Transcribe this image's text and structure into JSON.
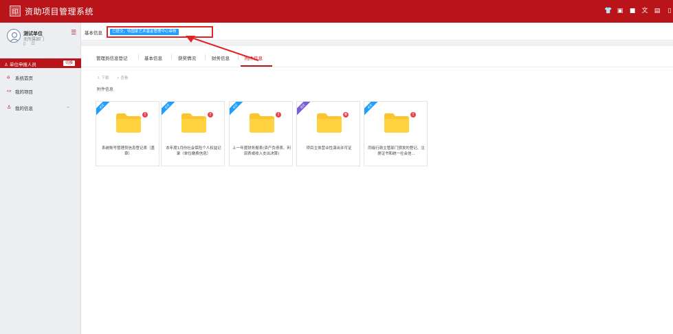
{
  "app": {
    "title": "资助项目管理系统",
    "logo_icon": "seal-logo-icon",
    "brand_color": "#b8141a"
  },
  "topbar": {
    "icons": [
      {
        "name": "shirt-icon",
        "glyph": "👕"
      },
      {
        "name": "archive-icon",
        "glyph": "▣"
      },
      {
        "name": "message-icon",
        "glyph": "■"
      },
      {
        "name": "font-icon",
        "glyph": "文"
      },
      {
        "name": "translate-icon",
        "glyph": "▤"
      },
      {
        "name": "more-icon",
        "glyph": "▯"
      }
    ]
  },
  "sidebar": {
    "unit_name": "测试单位",
    "unit_dept": "无所属部门",
    "mini_icons": [
      "▯",
      "☷"
    ],
    "role": "单位申报人员",
    "switch_label": "切换",
    "items": [
      {
        "label": "系统首页",
        "icon": "⌂",
        "icon_name": "home-icon"
      },
      {
        "label": "我的项目",
        "icon": "▭",
        "icon_name": "folder-icon"
      },
      {
        "label": "我的信息",
        "icon": "♙",
        "icon_name": "user-icon",
        "arrow": "⌄"
      }
    ]
  },
  "header": {
    "breadcrumb": "基本信息",
    "status": "已提交，待国家艺术基金管理中心审核"
  },
  "tabs": [
    {
      "label": "管理员信息登记",
      "active": false
    },
    {
      "label": "基本信息",
      "active": false
    },
    {
      "label": "获奖情况",
      "active": false
    },
    {
      "label": "财务信息",
      "active": false
    },
    {
      "label": "附件信息",
      "active": true
    }
  ],
  "toolbar": {
    "download": "下载",
    "view": "查看"
  },
  "section_label": "附件信息",
  "attachments": [
    {
      "name": "系统账号管理员信息登记表（盖章）",
      "badge": "!",
      "ribbon": "必交",
      "ribbon_color": "#1e9fff"
    },
    {
      "name": "本年度1月份社会保险个人权益记录（单位缴费信息）",
      "badge": "!",
      "ribbon": "必交",
      "ribbon_color": "#1e9fff"
    },
    {
      "name": "上一年度财务报表(资产负债表、利润表或收入支出决算)",
      "badge": "!",
      "ribbon": "必交",
      "ribbon_color": "#1e9fff"
    },
    {
      "name": "项目主体营业性演出许可证",
      "badge": "0",
      "ribbon": "选交",
      "ribbon_color": "#7b5bd6"
    },
    {
      "name": "同级行政主管部门颁发的登记、注册证书和统一社会信...",
      "badge": "!",
      "ribbon": "必交",
      "ribbon_color": "#1e9fff"
    }
  ]
}
